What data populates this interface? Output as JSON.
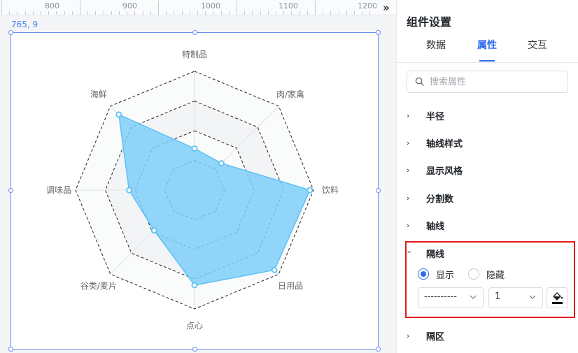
{
  "ruler": {
    "labels": [
      "800",
      "900",
      "1000",
      "1100",
      "1200"
    ],
    "expand_icon": "chevrons-right-icon"
  },
  "canvas": {
    "coord_readout": "765, 9"
  },
  "chart_data": {
    "type": "radar",
    "categories": [
      "特制品",
      "肉/家禽",
      "饮料",
      "日用品",
      "点心",
      "谷类/麦片",
      "调味品",
      "海鲜"
    ],
    "values": [
      0.35,
      0.32,
      0.97,
      0.95,
      0.8,
      0.48,
      0.55,
      0.9
    ],
    "max": 1,
    "split_number": 4,
    "fill_color": "#7ecff9",
    "line_color": "#5bc1f5",
    "split_line_style": "dashed"
  },
  "panel": {
    "title": "组件设置",
    "tabs": [
      {
        "label": "数据",
        "active": false
      },
      {
        "label": "属性",
        "active": true
      },
      {
        "label": "交互",
        "active": false
      }
    ],
    "search_placeholder": "搜索属性",
    "sections": [
      {
        "label": "半径",
        "expanded": false
      },
      {
        "label": "轴线样式",
        "expanded": false
      },
      {
        "label": "显示风格",
        "expanded": false
      },
      {
        "label": "分割数",
        "expanded": false
      },
      {
        "label": "轴线",
        "expanded": false
      },
      {
        "label": "隔线",
        "expanded": true
      },
      {
        "label": "隔区",
        "expanded": false
      }
    ],
    "split_line": {
      "radio_show": "显示",
      "radio_hide": "隐藏",
      "selected": "显示",
      "line_style_value": "----------",
      "width_value": "1",
      "color": "#000000"
    }
  }
}
